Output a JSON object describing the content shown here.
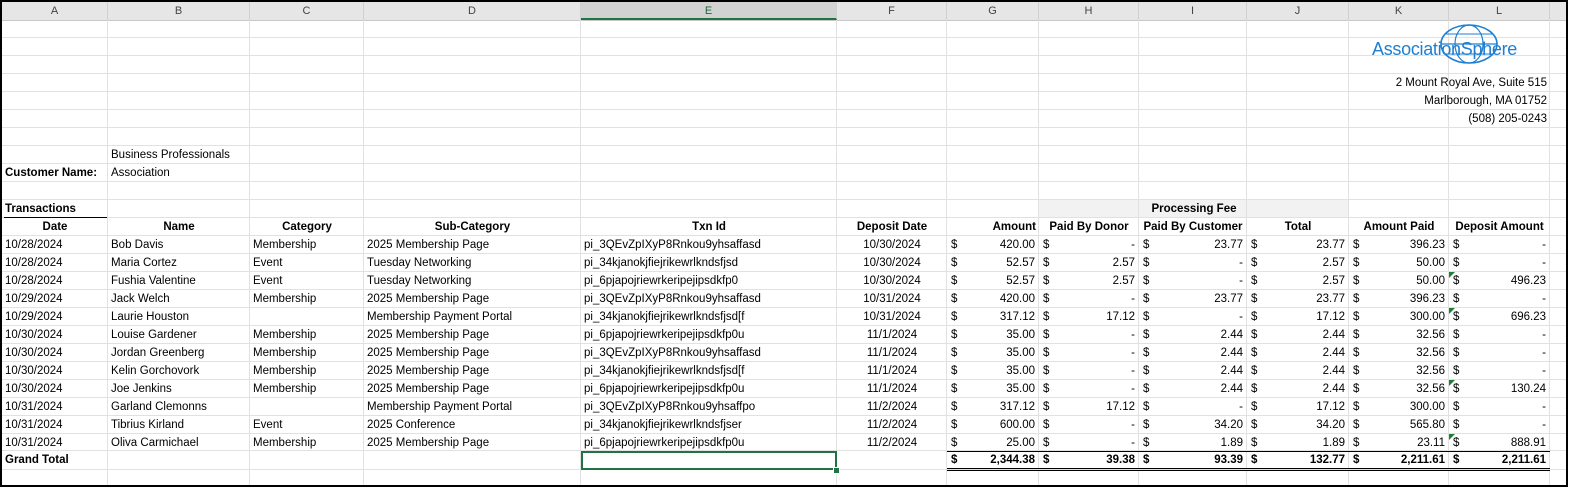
{
  "columns": [
    "A",
    "B",
    "C",
    "D",
    "E",
    "F",
    "G",
    "H",
    "I",
    "J",
    "K",
    "L"
  ],
  "company": {
    "name": "AssociationSphere",
    "address1": "2 Mount Royal Ave, Suite 515",
    "address2": "Marlborough, MA 01752",
    "phone": "(508) 205-0243"
  },
  "customer": {
    "label": "Customer Name:",
    "line1": "Business Professionals",
    "line2": "Association"
  },
  "section_title": "Transactions",
  "group_header": "Processing Fee",
  "headers": {
    "date": "Date",
    "name": "Name",
    "category": "Category",
    "subcategory": "Sub-Category",
    "txn": "Txn Id",
    "deposit_date": "Deposit Date",
    "amount": "Amount",
    "paid_donor": "Paid By Donor",
    "paid_customer": "Paid By Customer",
    "total": "Total",
    "amount_paid": "Amount Paid",
    "deposit_amount": "Deposit Amount"
  },
  "currency": "$",
  "rows": [
    {
      "date": "10/28/2024",
      "name": "Bob Davis",
      "category": "Membership",
      "sub": "2025 Membership Page",
      "txn": "pi_3QEvZpIXyP8Rnkou9yhsaffasd",
      "dep": "10/30/2024",
      "amount": "420.00",
      "donor": "-",
      "cust": "23.77",
      "total": "23.77",
      "paid": "396.23",
      "deposit": "-"
    },
    {
      "date": "10/28/2024",
      "name": "Maria Cortez",
      "category": "Event",
      "sub": "Tuesday Networking",
      "txn": "pi_34kjanokjfiejrikewrlkndsfjsd",
      "dep": "10/30/2024",
      "amount": "52.57",
      "donor": "2.57",
      "cust": "-",
      "total": "2.57",
      "paid": "50.00",
      "deposit": "-"
    },
    {
      "date": "10/28/2024",
      "name": "Fushia Valentine",
      "category": "Event",
      "sub": "Tuesday Networking",
      "txn": "pi_6pjapojriewrkeripejipsdkfp0",
      "dep": "10/30/2024",
      "amount": "52.57",
      "donor": "2.57",
      "cust": "-",
      "total": "2.57",
      "paid": "50.00",
      "deposit": "496.23"
    },
    {
      "date": "10/29/2024",
      "name": "Jack Welch",
      "category": "Membership",
      "sub": "2025 Membership Page",
      "txn": "pi_3QEvZpIXyP8Rnkou9yhsaffasd",
      "dep": "10/31/2024",
      "amount": "420.00",
      "donor": "-",
      "cust": "23.77",
      "total": "23.77",
      "paid": "396.23",
      "deposit": "-"
    },
    {
      "date": "10/29/2024",
      "name": "Laurie Houston",
      "category": "",
      "sub": "Membership Payment Portal",
      "txn": "pi_34kjanokjfiejrikewrlkndsfjsd[f",
      "dep": "10/31/2024",
      "amount": "317.12",
      "donor": "17.12",
      "cust": "-",
      "total": "17.12",
      "paid": "300.00",
      "deposit": "696.23"
    },
    {
      "date": "10/30/2024",
      "name": "Louise Gardener",
      "category": "Membership",
      "sub": "2025 Membership Page",
      "txn": "pi_6pjapojriewrkeripejipsdkfp0u",
      "dep": "11/1/2024",
      "amount": "35.00",
      "donor": "-",
      "cust": "2.44",
      "total": "2.44",
      "paid": "32.56",
      "deposit": "-"
    },
    {
      "date": "10/30/2024",
      "name": "Jordan Greenberg",
      "category": "Membership",
      "sub": "2025 Membership Page",
      "txn": "pi_3QEvZpIXyP8Rnkou9yhsaffasd",
      "dep": "11/1/2024",
      "amount": "35.00",
      "donor": "-",
      "cust": "2.44",
      "total": "2.44",
      "paid": "32.56",
      "deposit": "-"
    },
    {
      "date": "10/30/2024",
      "name": "Kelin Gorchovork",
      "category": "Membership",
      "sub": "2025 Membership Page",
      "txn": "pi_34kjanokjfiejrikewrlkndsfjsd[f",
      "dep": "11/1/2024",
      "amount": "35.00",
      "donor": "-",
      "cust": "2.44",
      "total": "2.44",
      "paid": "32.56",
      "deposit": "-"
    },
    {
      "date": "10/30/2024",
      "name": "Joe Jenkins",
      "category": "Membership",
      "sub": "2025 Membership Page",
      "txn": "pi_6pjapojriewrkeripejipsdkfp0u",
      "dep": "11/1/2024",
      "amount": "35.00",
      "donor": "-",
      "cust": "2.44",
      "total": "2.44",
      "paid": "32.56",
      "deposit": "130.24"
    },
    {
      "date": "10/31/2024",
      "name": "Garland Clemonns",
      "category": "",
      "sub": "Membership Payment Portal",
      "txn": "pi_3QEvZpIXyP8Rnkou9yhsaffpo",
      "dep": "11/2/2024",
      "amount": "317.12",
      "donor": "17.12",
      "cust": "-",
      "total": "17.12",
      "paid": "300.00",
      "deposit": "-"
    },
    {
      "date": "10/31/2024",
      "name": "Tibrius Kirland",
      "category": "Event",
      "sub": "2025 Conference",
      "txn": "pi_34kjanokjfiejrikewrlkndsfjser",
      "dep": "11/2/2024",
      "amount": "600.00",
      "donor": "-",
      "cust": "34.20",
      "total": "34.20",
      "paid": "565.80",
      "deposit": "-"
    },
    {
      "date": "10/31/2024",
      "name": "Oliva Carmichael",
      "category": "Membership",
      "sub": "2025 Membership Page",
      "txn": "pi_6pjapojriewrkeripejipsdkfp0u",
      "dep": "11/2/2024",
      "amount": "25.00",
      "donor": "-",
      "cust": "1.89",
      "total": "1.89",
      "paid": "23.11",
      "deposit": "888.91"
    }
  ],
  "grand_total": {
    "label": "Grand Total",
    "amount": "2,344.38",
    "donor": "39.38",
    "cust": "93.39",
    "total": "132.77",
    "paid": "2,211.61",
    "deposit": "2,211.61"
  },
  "colors": {
    "selection": "#217346",
    "logo_blue": "#1f7fd1",
    "header_bg": "#e6e6e6"
  }
}
